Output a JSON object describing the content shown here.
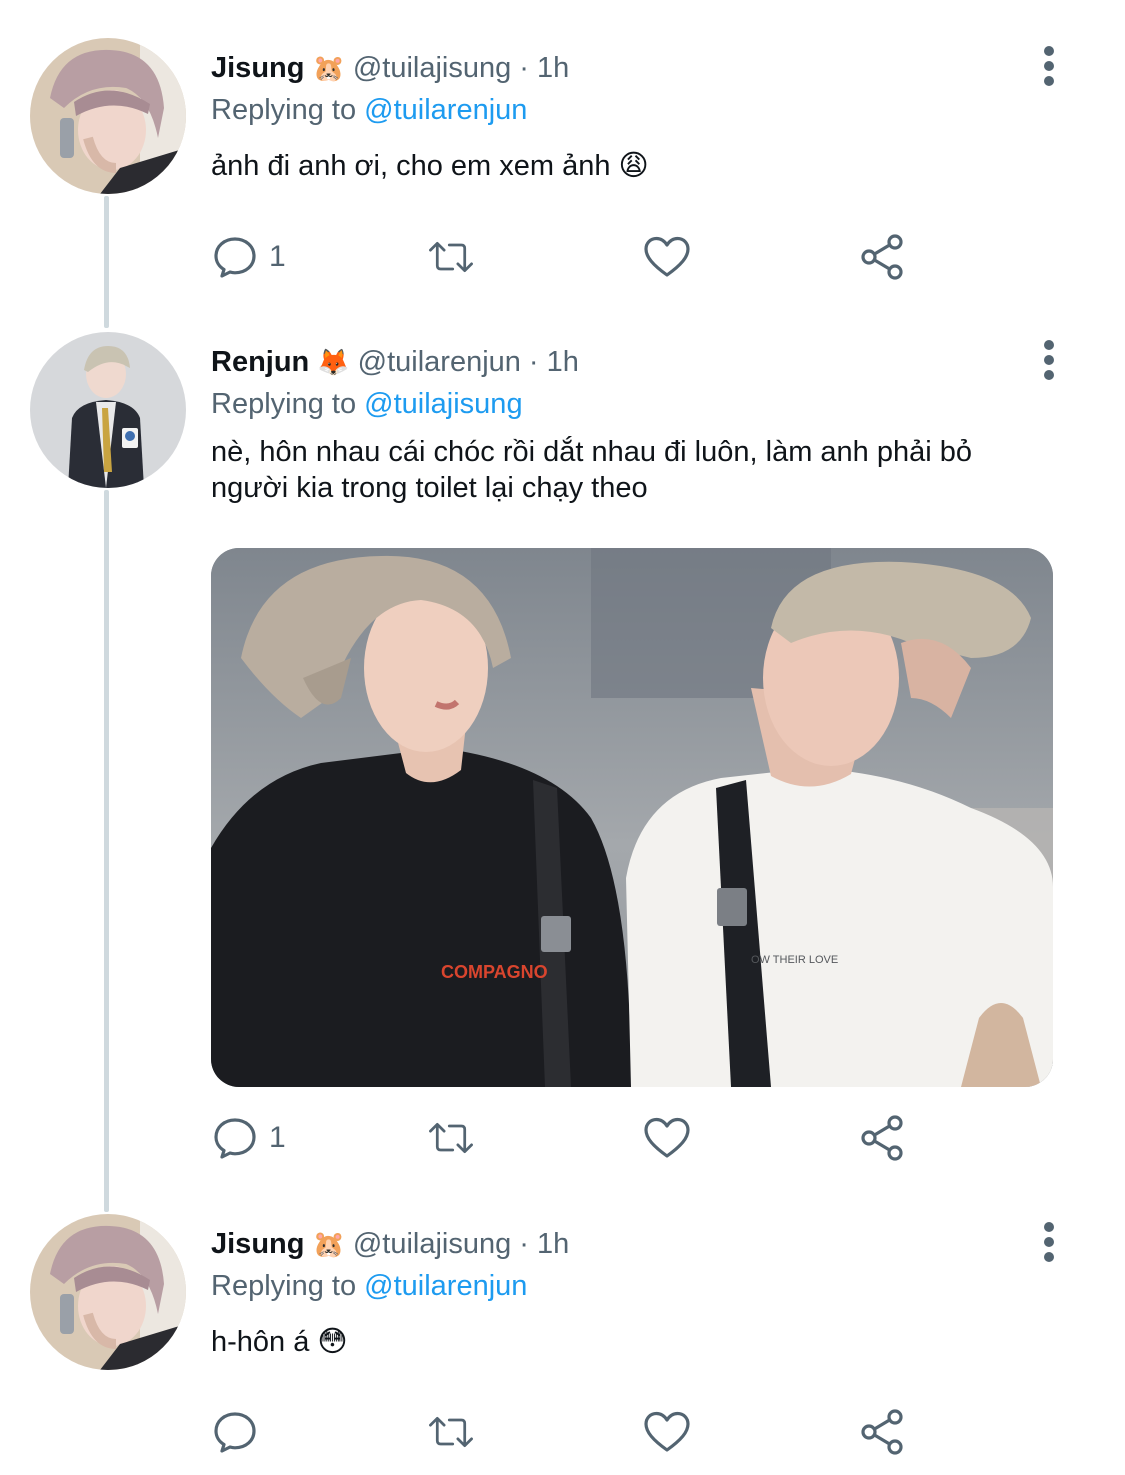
{
  "tweets": [
    {
      "name": "Jisung",
      "emoji": "🐹",
      "handle": "@tuilajisung",
      "dot": "·",
      "time": "1h",
      "replying_prefix": "Replying to",
      "replying_to": "@tuilarenjun",
      "text": "ảnh đi anh ơi, cho em xem ảnh 😩",
      "reply_count": "1"
    },
    {
      "name": "Renjun",
      "emoji": "🦊",
      "handle": "@tuilarenjun",
      "dot": "·",
      "time": "1h",
      "replying_prefix": "Replying to",
      "replying_to": "@tuilajisung",
      "text_line1": "nè, hôn nhau cái chóc rồi dắt nhau đi luôn, làm anh phải bỏ",
      "text_line2": "người kia trong toilet lại chạy theo",
      "reply_count": "1",
      "media": {
        "shirt_text_left": "COMPAGNO",
        "shirt_text_right": "OW THEIR LOVE"
      }
    },
    {
      "name": "Jisung",
      "emoji": "🐹",
      "handle": "@tuilajisung",
      "dot": "·",
      "time": "1h",
      "replying_prefix": "Replying to",
      "replying_to": "@tuilarenjun",
      "text": "h-hôn á 😳",
      "reply_count": ""
    }
  ],
  "icons": [
    "reply-icon",
    "retweet-icon",
    "like-icon",
    "share-icon",
    "more-icon"
  ],
  "colors": {
    "link": "#1d9bf0",
    "secondary": "#536471",
    "thread_line": "#cfd9de"
  }
}
